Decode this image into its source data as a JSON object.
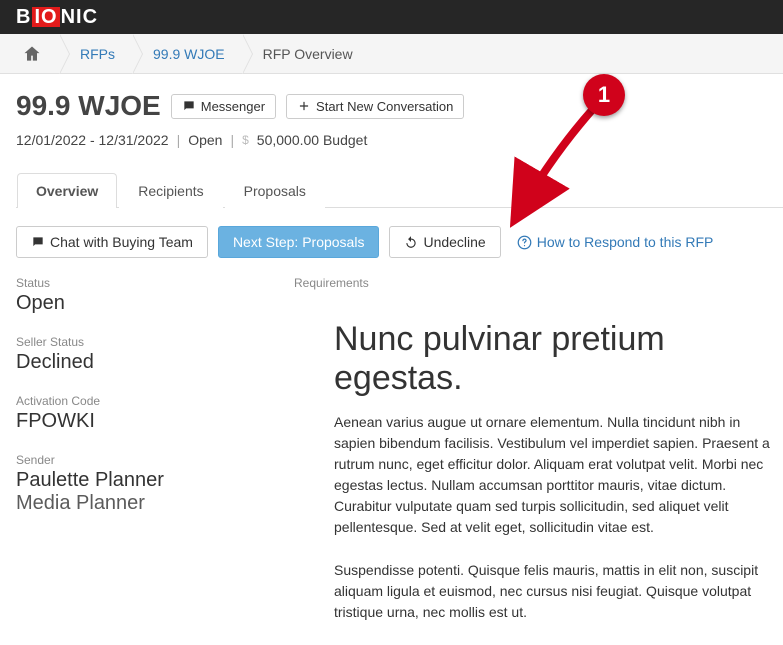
{
  "logo": {
    "pre": "B",
    "mid": "IO",
    "post": "NIC"
  },
  "breadcrumbs": {
    "rfps": "RFPs",
    "station": "99.9 WJOE",
    "current": "RFP Overview"
  },
  "header": {
    "title": "99.9 WJOE",
    "messenger_label": "Messenger",
    "new_convo_label": "Start New Conversation",
    "dates": "12/01/2022 - 12/31/2022",
    "status": "Open",
    "budget": "50,000.00 Budget"
  },
  "tabs": {
    "overview": "Overview",
    "recipients": "Recipients",
    "proposals": "Proposals"
  },
  "actions": {
    "chat_label": "Chat with Buying Team",
    "next_step_label": "Next Step: Proposals",
    "undecline_label": "Undecline",
    "help_label": "How to Respond to this RFP"
  },
  "meta": {
    "status_label": "Status",
    "status_value": "Open",
    "seller_status_label": "Seller Status",
    "seller_status_value": "Declined",
    "activation_label": "Activation Code",
    "activation_value": "FPOWKI",
    "sender_label": "Sender",
    "sender_name": "Paulette Planner",
    "sender_title": "Media Planner"
  },
  "requirements": {
    "label": "Requirements",
    "heading": "Nunc pulvinar pretium egestas.",
    "para1": "Aenean varius augue ut ornare elementum. Nulla tincidunt nibh in sapien bibendum facilisis. Vestibulum vel imperdiet sapien. Praesent a rutrum nunc, eget efficitur dolor. Aliquam erat volutpat velit. Morbi nec egestas lectus. Nullam accumsan porttitor mauris, vitae dictum. Curabitur vulputate quam sed turpis sollicitudin, sed aliquet velit pellentesque. Sed at velit eget, sollicitudin vitae est.",
    "para2": "Suspendisse potenti. Quisque felis mauris, mattis in elit non, suscipit aliquam ligula et euismod, nec cursus nisi feugiat. Quisque volutpat tristique urna, nec mollis est ut."
  },
  "callout": {
    "number": "1"
  }
}
